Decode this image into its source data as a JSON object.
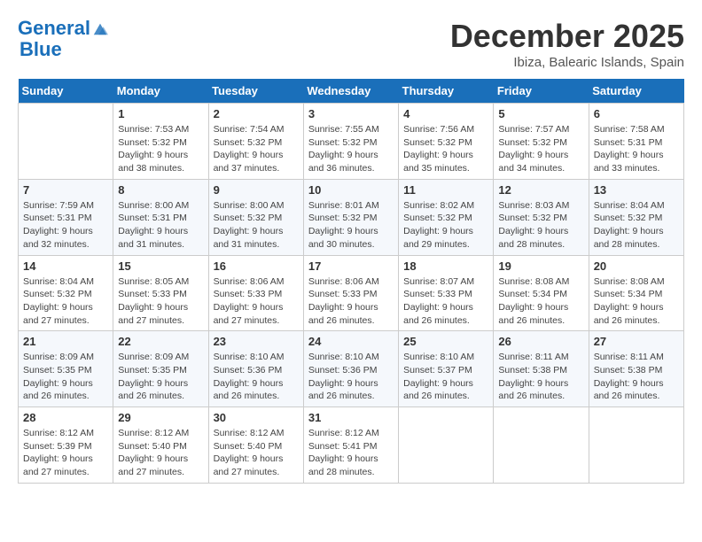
{
  "header": {
    "logo_line1": "General",
    "logo_line2": "Blue",
    "month": "December 2025",
    "location": "Ibiza, Balearic Islands, Spain"
  },
  "weekdays": [
    "Sunday",
    "Monday",
    "Tuesday",
    "Wednesday",
    "Thursday",
    "Friday",
    "Saturday"
  ],
  "weeks": [
    [
      {
        "day": "",
        "sunrise": "",
        "sunset": "",
        "daylight": ""
      },
      {
        "day": "1",
        "sunrise": "7:53 AM",
        "sunset": "5:32 PM",
        "daylight": "9 hours and 38 minutes."
      },
      {
        "day": "2",
        "sunrise": "7:54 AM",
        "sunset": "5:32 PM",
        "daylight": "9 hours and 37 minutes."
      },
      {
        "day": "3",
        "sunrise": "7:55 AM",
        "sunset": "5:32 PM",
        "daylight": "9 hours and 36 minutes."
      },
      {
        "day": "4",
        "sunrise": "7:56 AM",
        "sunset": "5:32 PM",
        "daylight": "9 hours and 35 minutes."
      },
      {
        "day": "5",
        "sunrise": "7:57 AM",
        "sunset": "5:32 PM",
        "daylight": "9 hours and 34 minutes."
      },
      {
        "day": "6",
        "sunrise": "7:58 AM",
        "sunset": "5:31 PM",
        "daylight": "9 hours and 33 minutes."
      }
    ],
    [
      {
        "day": "7",
        "sunrise": "7:59 AM",
        "sunset": "5:31 PM",
        "daylight": "9 hours and 32 minutes."
      },
      {
        "day": "8",
        "sunrise": "8:00 AM",
        "sunset": "5:31 PM",
        "daylight": "9 hours and 31 minutes."
      },
      {
        "day": "9",
        "sunrise": "8:00 AM",
        "sunset": "5:32 PM",
        "daylight": "9 hours and 31 minutes."
      },
      {
        "day": "10",
        "sunrise": "8:01 AM",
        "sunset": "5:32 PM",
        "daylight": "9 hours and 30 minutes."
      },
      {
        "day": "11",
        "sunrise": "8:02 AM",
        "sunset": "5:32 PM",
        "daylight": "9 hours and 29 minutes."
      },
      {
        "day": "12",
        "sunrise": "8:03 AM",
        "sunset": "5:32 PM",
        "daylight": "9 hours and 28 minutes."
      },
      {
        "day": "13",
        "sunrise": "8:04 AM",
        "sunset": "5:32 PM",
        "daylight": "9 hours and 28 minutes."
      }
    ],
    [
      {
        "day": "14",
        "sunrise": "8:04 AM",
        "sunset": "5:32 PM",
        "daylight": "9 hours and 27 minutes."
      },
      {
        "day": "15",
        "sunrise": "8:05 AM",
        "sunset": "5:33 PM",
        "daylight": "9 hours and 27 minutes."
      },
      {
        "day": "16",
        "sunrise": "8:06 AM",
        "sunset": "5:33 PM",
        "daylight": "9 hours and 27 minutes."
      },
      {
        "day": "17",
        "sunrise": "8:06 AM",
        "sunset": "5:33 PM",
        "daylight": "9 hours and 26 minutes."
      },
      {
        "day": "18",
        "sunrise": "8:07 AM",
        "sunset": "5:33 PM",
        "daylight": "9 hours and 26 minutes."
      },
      {
        "day": "19",
        "sunrise": "8:08 AM",
        "sunset": "5:34 PM",
        "daylight": "9 hours and 26 minutes."
      },
      {
        "day": "20",
        "sunrise": "8:08 AM",
        "sunset": "5:34 PM",
        "daylight": "9 hours and 26 minutes."
      }
    ],
    [
      {
        "day": "21",
        "sunrise": "8:09 AM",
        "sunset": "5:35 PM",
        "daylight": "9 hours and 26 minutes."
      },
      {
        "day": "22",
        "sunrise": "8:09 AM",
        "sunset": "5:35 PM",
        "daylight": "9 hours and 26 minutes."
      },
      {
        "day": "23",
        "sunrise": "8:10 AM",
        "sunset": "5:36 PM",
        "daylight": "9 hours and 26 minutes."
      },
      {
        "day": "24",
        "sunrise": "8:10 AM",
        "sunset": "5:36 PM",
        "daylight": "9 hours and 26 minutes."
      },
      {
        "day": "25",
        "sunrise": "8:10 AM",
        "sunset": "5:37 PM",
        "daylight": "9 hours and 26 minutes."
      },
      {
        "day": "26",
        "sunrise": "8:11 AM",
        "sunset": "5:38 PM",
        "daylight": "9 hours and 26 minutes."
      },
      {
        "day": "27",
        "sunrise": "8:11 AM",
        "sunset": "5:38 PM",
        "daylight": "9 hours and 26 minutes."
      }
    ],
    [
      {
        "day": "28",
        "sunrise": "8:12 AM",
        "sunset": "5:39 PM",
        "daylight": "9 hours and 27 minutes."
      },
      {
        "day": "29",
        "sunrise": "8:12 AM",
        "sunset": "5:40 PM",
        "daylight": "9 hours and 27 minutes."
      },
      {
        "day": "30",
        "sunrise": "8:12 AM",
        "sunset": "5:40 PM",
        "daylight": "9 hours and 27 minutes."
      },
      {
        "day": "31",
        "sunrise": "8:12 AM",
        "sunset": "5:41 PM",
        "daylight": "9 hours and 28 minutes."
      },
      {
        "day": "",
        "sunrise": "",
        "sunset": "",
        "daylight": ""
      },
      {
        "day": "",
        "sunrise": "",
        "sunset": "",
        "daylight": ""
      },
      {
        "day": "",
        "sunrise": "",
        "sunset": "",
        "daylight": ""
      }
    ]
  ]
}
